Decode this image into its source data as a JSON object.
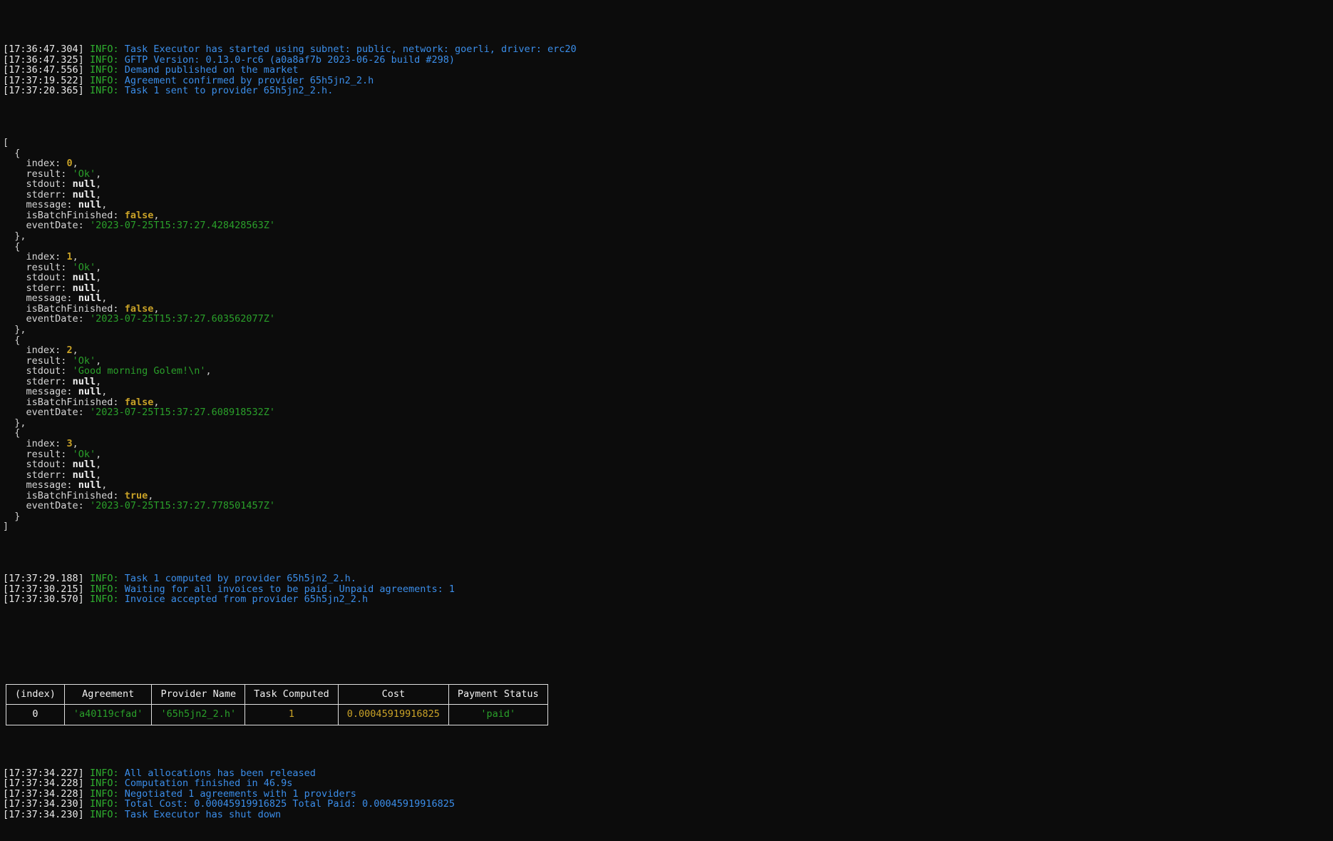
{
  "terminal": {
    "prompt_lines_top": [
      {
        "time": "[17:36:47.304]",
        "level": "INFO:",
        "message": "Task Executor has started using subnet: public, network: goerli, driver: erc20"
      },
      {
        "time": "[17:36:47.325]",
        "level": "INFO:",
        "message": "GFTP Version: 0.13.0-rc6 (a0a8af7b 2023-06-26 build #298)"
      },
      {
        "time": "[17:36:47.556]",
        "level": "INFO:",
        "message": "Demand published on the market"
      },
      {
        "time": "[17:37:19.522]",
        "level": "INFO:",
        "message": "Agreement confirmed by provider 65h5jn2_2.h"
      },
      {
        "time": "[17:37:20.365]",
        "level": "INFO:",
        "message": "Task 1 sent to provider 65h5jn2_2.h."
      }
    ],
    "json_dump": {
      "open_bracket": "[",
      "close_bracket": "]",
      "open_brace": "{",
      "close_brace_comma": "},",
      "close_brace": "}",
      "keys": {
        "index": "index:",
        "result": "result:",
        "stdout": "stdout:",
        "stderr": "stderr:",
        "message": "message:",
        "isBatchFinished": "isBatchFinished:",
        "eventDate": "eventDate:"
      },
      "comma": ",",
      "entries": [
        {
          "index": "0",
          "result": "'Ok'",
          "stdout": "null",
          "stdout_type": "null",
          "stderr": "null",
          "message": "null",
          "isBatchFinished": "false",
          "eventDate": "'2023-07-25T15:37:27.428428563Z'"
        },
        {
          "index": "1",
          "result": "'Ok'",
          "stdout": "null",
          "stdout_type": "null",
          "stderr": "null",
          "message": "null",
          "isBatchFinished": "false",
          "eventDate": "'2023-07-25T15:37:27.603562077Z'"
        },
        {
          "index": "2",
          "result": "'Ok'",
          "stdout": "'Good morning Golem!\\n'",
          "stdout_type": "string",
          "stderr": "null",
          "message": "null",
          "isBatchFinished": "false",
          "eventDate": "'2023-07-25T15:37:27.608918532Z'"
        },
        {
          "index": "3",
          "result": "'Ok'",
          "stdout": "null",
          "stdout_type": "null",
          "stderr": "null",
          "message": "null",
          "isBatchFinished": "true",
          "eventDate": "'2023-07-25T15:37:27.778501457Z'"
        }
      ]
    },
    "prompt_lines_mid": [
      {
        "time": "[17:37:29.188]",
        "level": "INFO:",
        "message": "Task 1 computed by provider 65h5jn2_2.h."
      },
      {
        "time": "[17:37:30.215]",
        "level": "INFO:",
        "message": "Waiting for all invoices to be paid. Unpaid agreements: 1"
      },
      {
        "time": "[17:37:30.570]",
        "level": "INFO:",
        "message": "Invoice accepted from provider 65h5jn2_2.h"
      }
    ],
    "summary_table": {
      "headers": [
        "(index)",
        "Agreement",
        "Provider Name",
        "Task Computed",
        "Cost",
        "Payment Status"
      ],
      "rows": [
        {
          "index": "0",
          "agreement": "'a40119cfad'",
          "provider_name": "'65h5jn2_2.h'",
          "task_computed": "1",
          "cost": "0.00045919916825",
          "payment_status": "'paid'"
        }
      ]
    },
    "prompt_lines_bottom": [
      {
        "time": "[17:37:34.227]",
        "level": "INFO:",
        "message": "All allocations has been released"
      },
      {
        "time": "[17:37:34.228]",
        "level": "INFO:",
        "message": "Computation finished in 46.9s"
      },
      {
        "time": "[17:37:34.228]",
        "level": "INFO:",
        "message": "Negotiated 1 agreements with 1 providers"
      },
      {
        "time": "[17:37:34.230]",
        "level": "INFO:",
        "message": "Total Cost: 0.00045919916825 Total Paid: 0.00045919916825"
      },
      {
        "time": "[17:37:34.230]",
        "level": "INFO:",
        "message": "Task Executor has shut down"
      }
    ]
  },
  "colors": {
    "background": "#0c0c0c",
    "timestamp": "#e9e9e9",
    "level_info": "#2faf2f",
    "message": "#3b8eea",
    "json_string": "#2aa02a",
    "json_number": "#c9a227",
    "json_null": "#f2f2f2",
    "json_bool": "#c9a227",
    "json_key": "#d6d6d6",
    "table_border": "#e0e0e0"
  }
}
